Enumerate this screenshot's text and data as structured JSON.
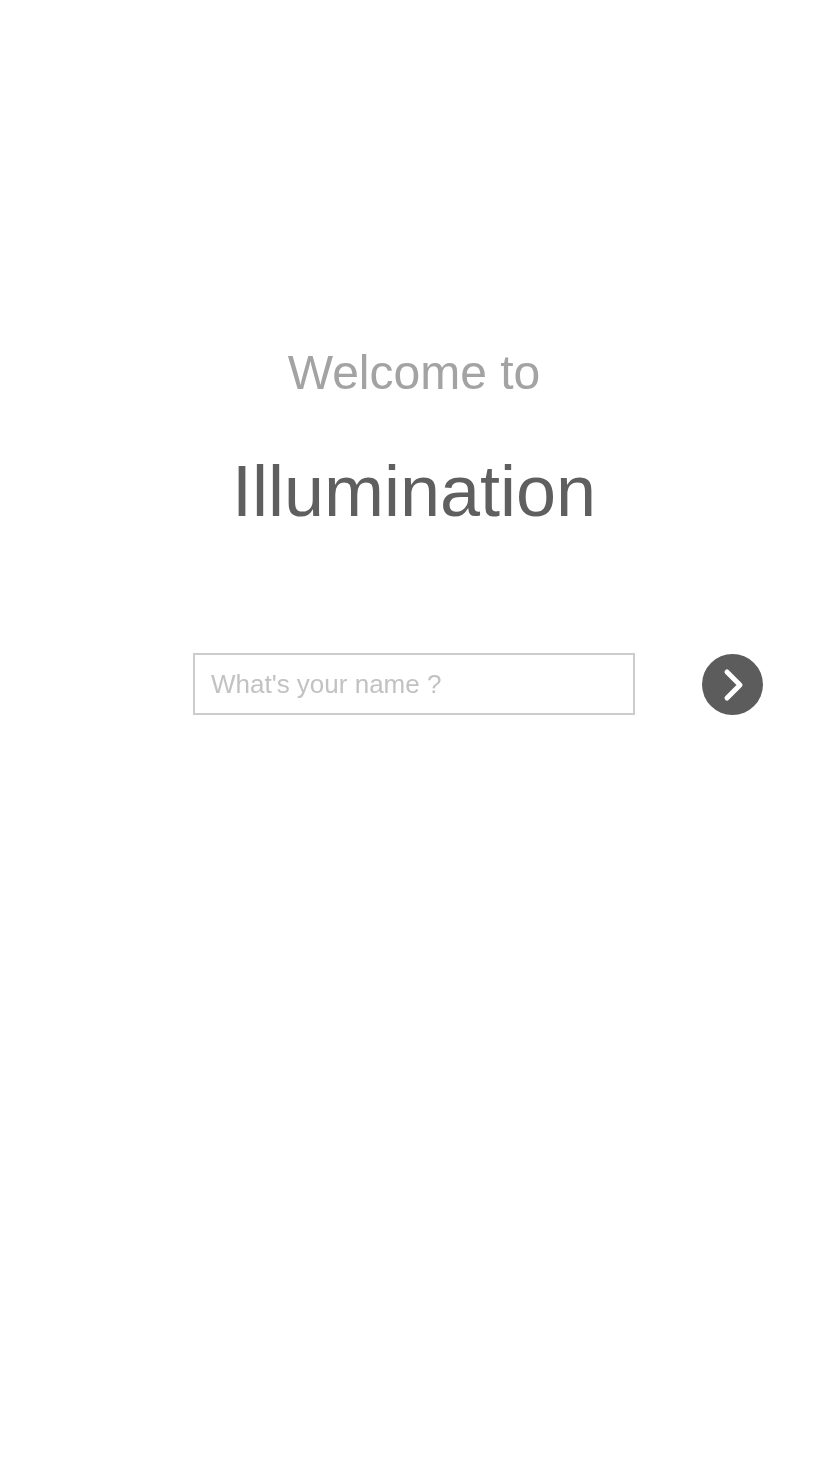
{
  "greeting": "Welcome to",
  "app_name": "Illumination",
  "name_field": {
    "placeholder": "What's your name ?"
  }
}
